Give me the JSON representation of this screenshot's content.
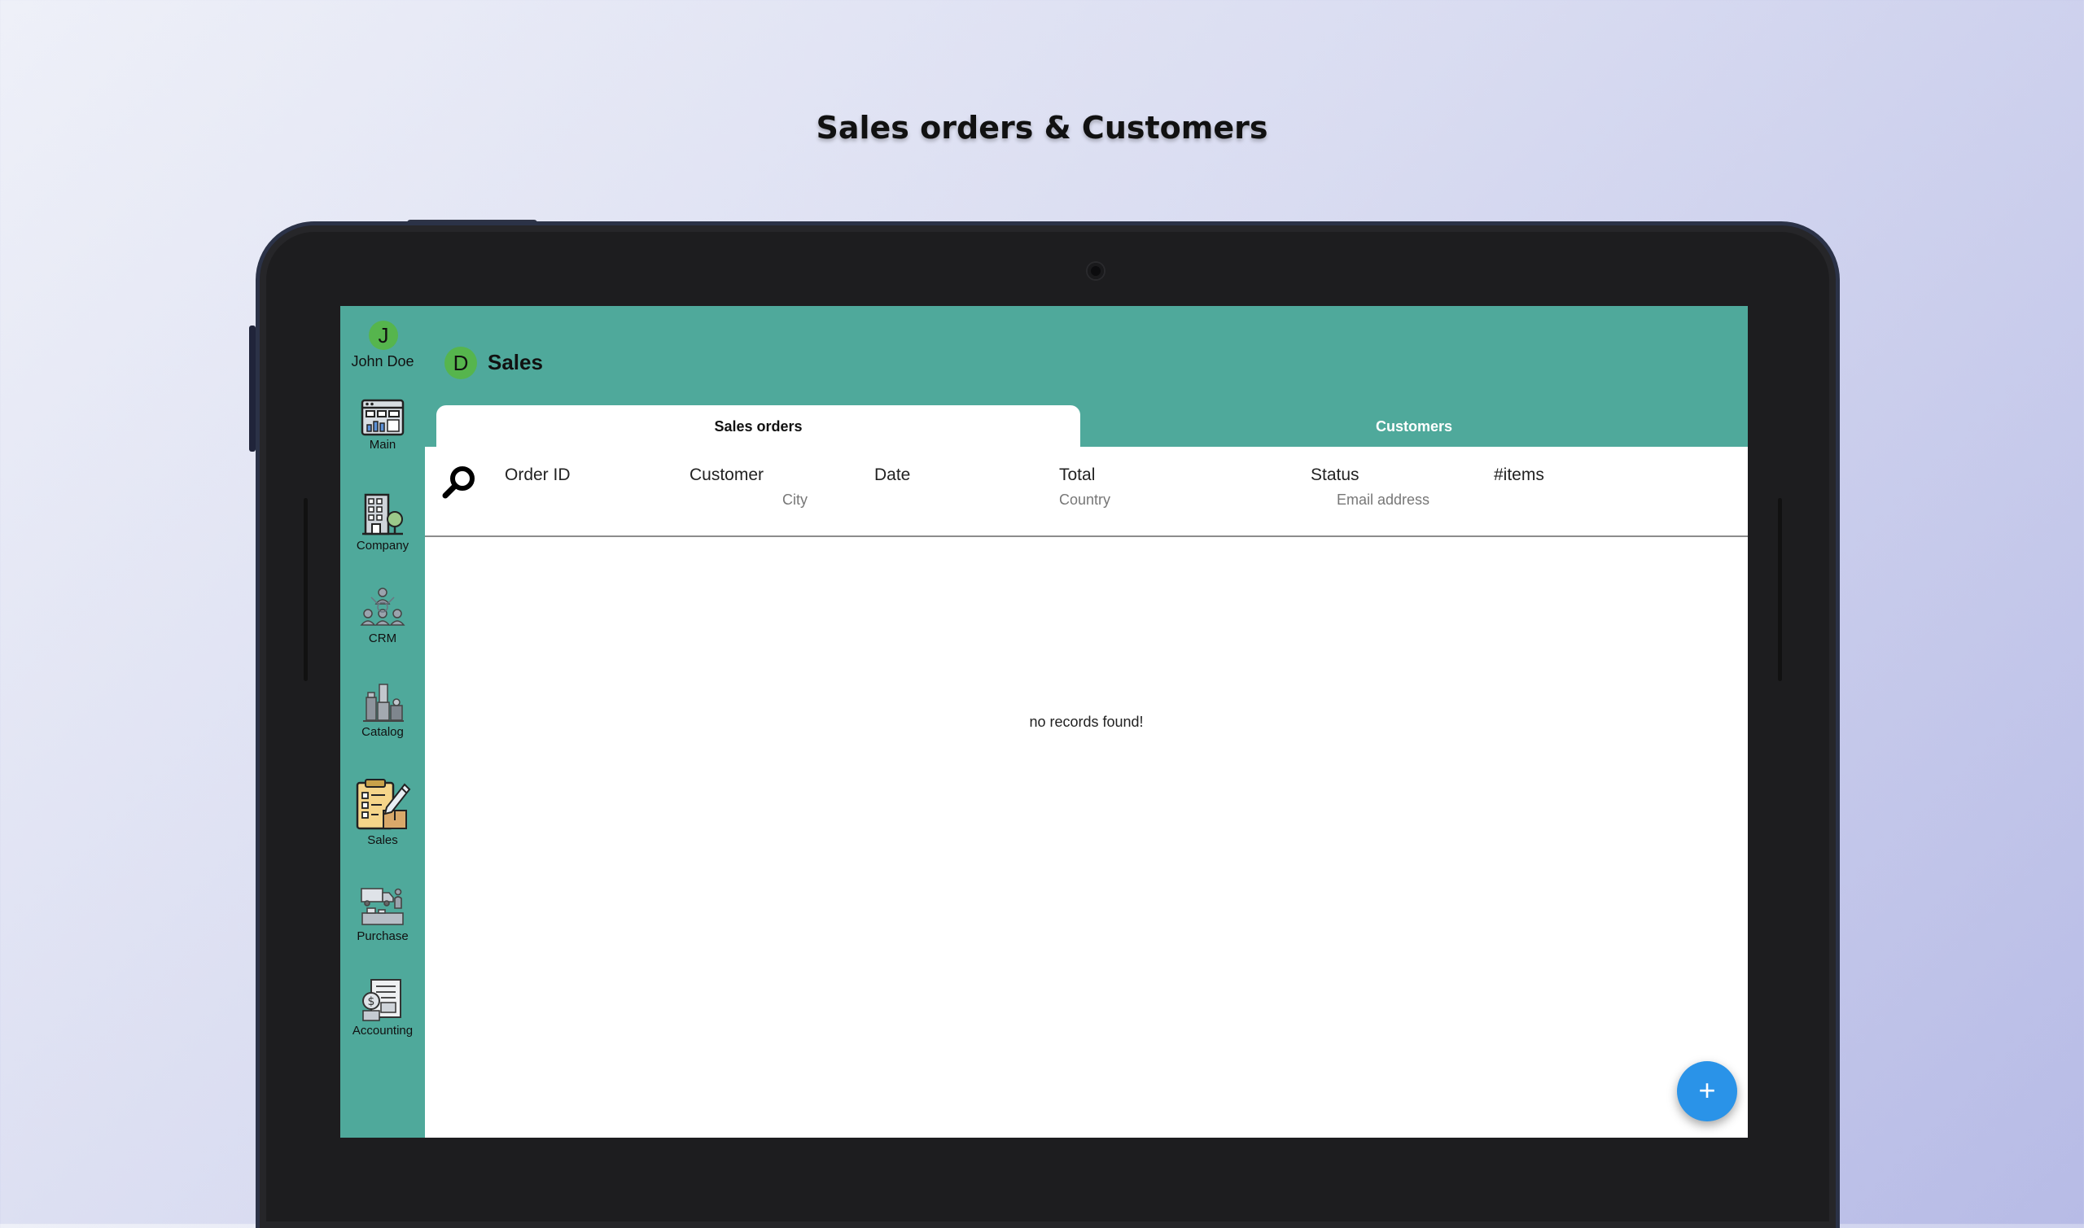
{
  "promo": {
    "title": "Sales orders & Customers"
  },
  "user": {
    "initial": "J",
    "name": "John Doe"
  },
  "nav": {
    "items": [
      {
        "label": "Main",
        "icon": "dashboard-icon"
      },
      {
        "label": "Company",
        "icon": "building-icon"
      },
      {
        "label": "CRM",
        "icon": "people-network-icon"
      },
      {
        "label": "Catalog",
        "icon": "products-icon"
      },
      {
        "label": "Sales",
        "icon": "clipboard-pencil-icon"
      },
      {
        "label": "Purchase",
        "icon": "truck-icon"
      },
      {
        "label": "Accounting",
        "icon": "invoice-icon"
      }
    ]
  },
  "header": {
    "avatar_initial": "D",
    "title": "Sales"
  },
  "tabs": [
    {
      "label": "Sales orders",
      "active": true
    },
    {
      "label": "Customers",
      "active": false
    }
  ],
  "table": {
    "columns": [
      {
        "label": "Order ID",
        "sub": ""
      },
      {
        "label": "Customer",
        "sub": "City"
      },
      {
        "label": "Date",
        "sub": ""
      },
      {
        "label": "Total",
        "sub": "Country"
      },
      {
        "label": "Status",
        "sub": "Email address"
      },
      {
        "label": "#items",
        "sub": ""
      }
    ],
    "empty_message": "no records found!"
  },
  "fab": {
    "label": "+"
  },
  "colors": {
    "primary": "#4fa99b",
    "avatar": "#56b54d",
    "fab": "#2a93e8"
  }
}
